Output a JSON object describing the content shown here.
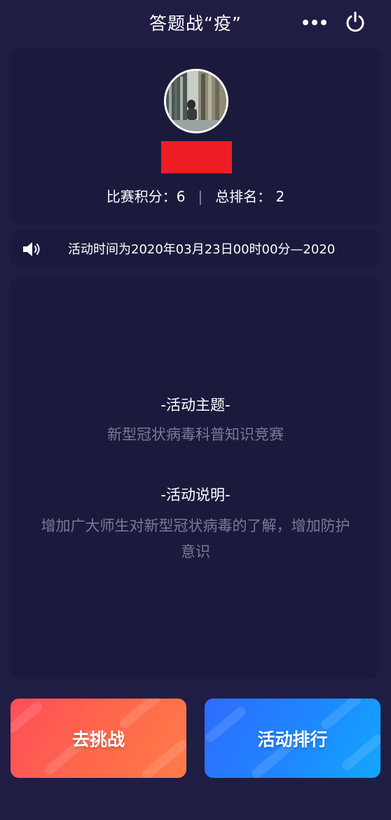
{
  "header": {
    "title": "答题战“疫”",
    "more_icon": "more-dots-icon",
    "power_icon": "power-icon"
  },
  "profile": {
    "score_label": "比赛积分：",
    "score_value": "6",
    "separator": "|",
    "rank_label": "总排名：",
    "rank_value": "2",
    "name_redacted_color": "#ee1d24"
  },
  "notice": {
    "icon": "speaker-icon",
    "text": "活动时间为2020年03月23日00时00分—2020"
  },
  "info": {
    "theme_heading": "-活动主题-",
    "theme_text": "新型冠状病毒科普知识竞赛",
    "desc_heading": "-活动说明-",
    "desc_text": "增加广大师生对新型冠状病毒的了解，增加防护意识"
  },
  "buttons": {
    "challenge_label": "去挑战",
    "ranking_label": "活动排行"
  },
  "colors": {
    "background": "#1f1d44",
    "card": "#1b1a3d",
    "challenge": "#ff5a52",
    "ranking": "#1e88ff"
  }
}
